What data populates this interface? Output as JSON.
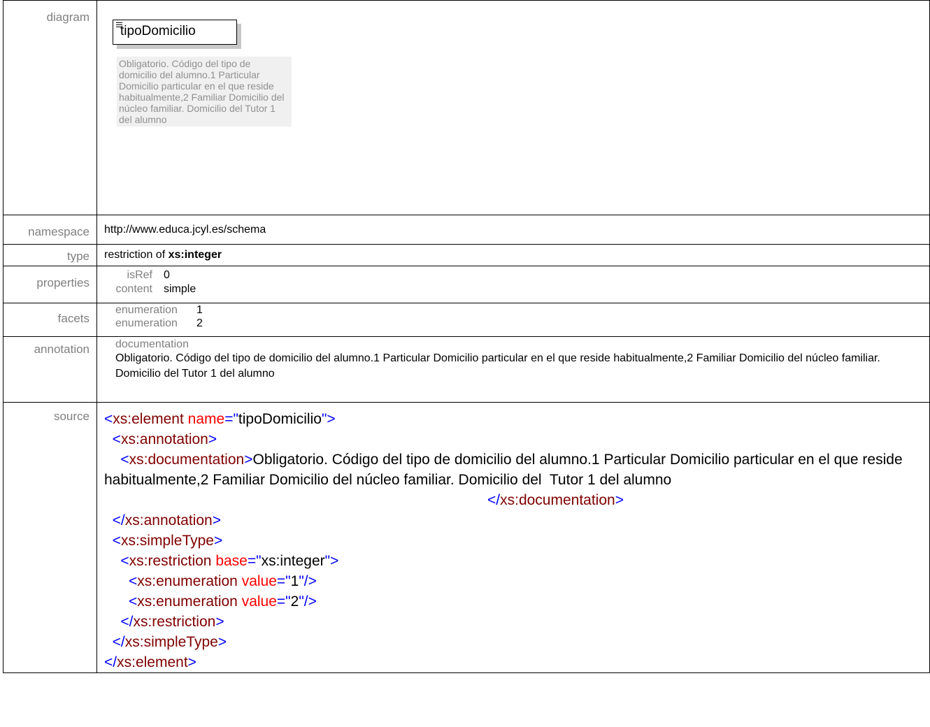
{
  "rows": {
    "diagram": {
      "label": "diagram",
      "element_name": "tipoDomicilio",
      "doc": "Obligatorio. Código del tipo de domicilio del alumno.1 Particular Domicilio particular en el que reside habitualmente,2 Familiar Domicilio del núcleo familiar. Domicilio del  Tutor 1 del alumno"
    },
    "namespace": {
      "label": "namespace",
      "value": "http://www.educa.jcyl.es/schema"
    },
    "type": {
      "label": "type",
      "prefix": "restriction of ",
      "base": "xs:integer"
    },
    "properties": {
      "label": "properties",
      "items": [
        {
          "key": "isRef",
          "value": "0"
        },
        {
          "key": "content",
          "value": "simple"
        }
      ]
    },
    "facets": {
      "label": "facets",
      "items": [
        {
          "key": "enumeration",
          "value": "1"
        },
        {
          "key": "enumeration",
          "value": "2"
        }
      ]
    },
    "annotation": {
      "label": "annotation",
      "title": "documentation",
      "text": "Obligatorio. Código del tipo de domicilio del alumno.1 Particular Domicilio particular en el que reside habitualmente,2 Familiar Domicilio del núcleo familiar. Domicilio del  Tutor 1 del alumno"
    },
    "source": {
      "label": "source",
      "lines": {
        "l1_open": "<",
        "l1_tag": "xs:element",
        "l1_attr": "name",
        "l1_eq": "=\"",
        "l1_val": "tipoDomicilio",
        "l1_close": "\">",
        "l2": "xs:annotation",
        "l3_tag": "xs:documentation",
        "doc_text": "Obligatorio. Código del tipo de domicilio del alumno.1 Particular Domicilio particular en el que reside habitualmente,2 Familiar Domicilio del núcleo familiar. Domicilio del  Tutor 1 del alumno",
        "l4_tag": "xs:documentation",
        "l5_tag": "xs:annotation",
        "l6_tag": "xs:simpleType",
        "l7_tag": "xs:restriction",
        "l7_attr": "base",
        "l7_val": "xs:integer",
        "l8_tag": "xs:enumeration",
        "l8_attr": "value",
        "l8_val": "1",
        "l9_tag": "xs:enumeration",
        "l9_attr": "value",
        "l9_val": "2",
        "l10_tag": "xs:restriction",
        "l11_tag": "xs:simpleType",
        "l12_tag": "xs:element"
      }
    }
  },
  "colors": {
    "tag_bracket": "#0000ff",
    "tag_name": "#800000",
    "attr_name": "#ff0000",
    "label": "#808080"
  }
}
